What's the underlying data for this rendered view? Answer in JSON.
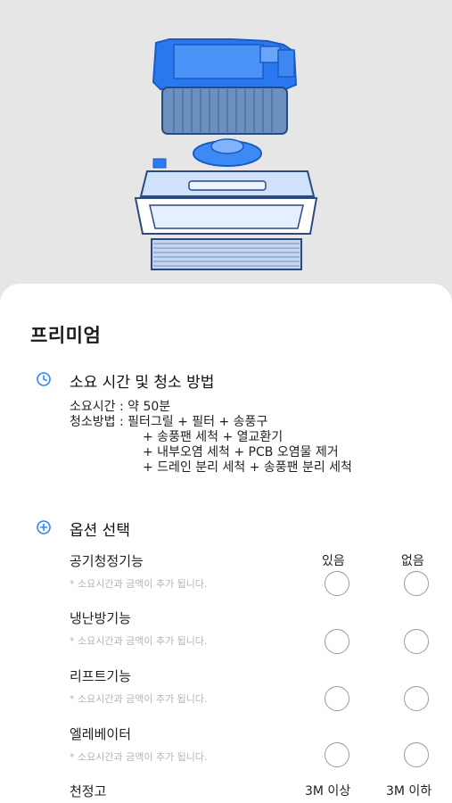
{
  "product": {
    "title": "프리미엄"
  },
  "duration_section": {
    "icon": "clock-icon",
    "title": "소요 시간 및 청소 방법",
    "time_line": "소요시간 : 약 50분",
    "method_line": "청소방법 : 필터그릴 + 필터 + 송풍구",
    "method_cont": [
      "+ 송풍팬 세척 + 열교환기",
      "+ 내부오염 세척 + PCB 오염물 제거",
      "+ 드레인 분리 세척 + 송풍팬 분리 세척"
    ]
  },
  "options_section": {
    "icon": "plus-circle-icon",
    "title": "옵션 선택",
    "col_yes": "있음",
    "col_no": "없음",
    "items": [
      {
        "label": "공기청정기능",
        "note": "* 소요시간과 금액이 추가 됩니다."
      },
      {
        "label": "냉난방기능",
        "note": "* 소요시간과 금액이 추가 됩니다."
      },
      {
        "label": "리프트기능",
        "note": "* 소요시간과 금액이 추가 됩니다."
      },
      {
        "label": "엘레베이터",
        "note": "* 소요시간과 금액이 추가 됩니다."
      }
    ],
    "ceiling": {
      "label": "천정고",
      "col_above": "3M 이상",
      "col_below": "3M 이하"
    }
  },
  "colors": {
    "accent": "#2f86ff",
    "device_blue": "#2e7bf0"
  }
}
